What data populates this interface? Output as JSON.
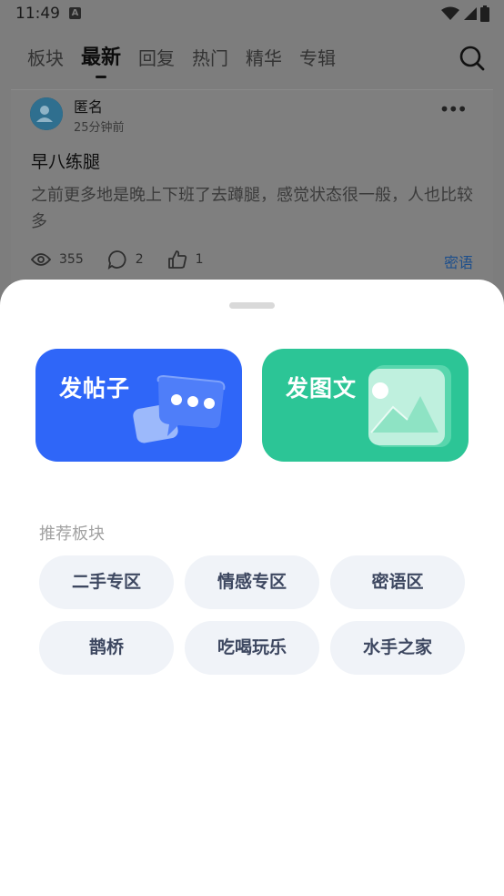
{
  "status_bar": {
    "time": "11:49"
  },
  "tabs": [
    {
      "label": "板块"
    },
    {
      "label": "最新",
      "active": true
    },
    {
      "label": "回复"
    },
    {
      "label": "热门"
    },
    {
      "label": "精华"
    },
    {
      "label": "专辑"
    }
  ],
  "post": {
    "username": "匿名",
    "time_ago": "25分钟前",
    "title": "早八练腿",
    "body": "之前更多地是晚上下班了去蹲腿，感觉状态很一般，人也比较多",
    "views": "355",
    "comments": "2",
    "likes": "1",
    "tag": "密语"
  },
  "sheet": {
    "actions": [
      {
        "label": "发帖子",
        "color": "#2f66f8"
      },
      {
        "label": "发图文",
        "color": "#2cc596"
      }
    ],
    "section_title": "推荐板块",
    "boards": [
      "二手专区",
      "情感专区",
      "密语区",
      "鹊桥",
      "吃喝玩乐",
      "水手之家"
    ]
  }
}
